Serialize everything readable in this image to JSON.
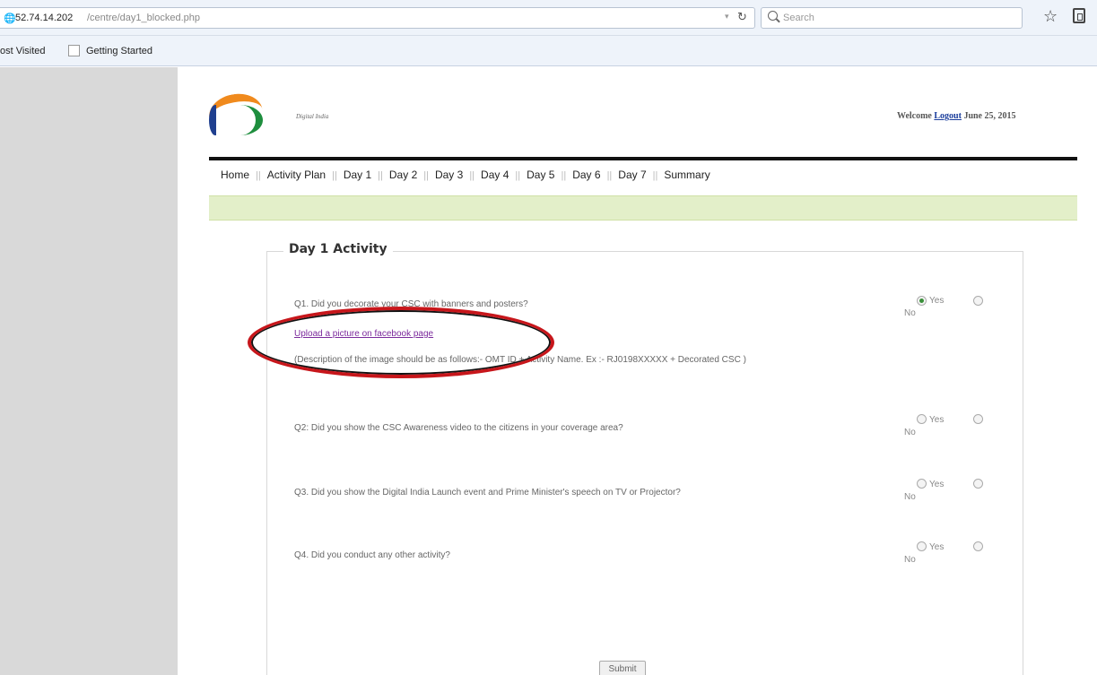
{
  "browser": {
    "url_host": "52.74.14.202",
    "url_path": "/centre/day1_blocked.php",
    "search_placeholder": "Search",
    "bookmarks": [
      "ost Visited",
      "Getting Started"
    ]
  },
  "header": {
    "logo_text": "Digital India",
    "welcome": "Welcome",
    "logout": "Logout",
    "date": "June 25, 2015"
  },
  "nav": {
    "items": [
      "Home",
      "Activity Plan",
      "Day 1",
      "Day 2",
      "Day 3",
      "Day 4",
      "Day 5",
      "Day 6",
      "Day 7",
      "Summary"
    ],
    "separator": "||"
  },
  "form": {
    "legend": "Day 1 Activity",
    "yes_label": "Yes",
    "no_label": "No",
    "questions": [
      {
        "text": "Q1. Did you decorate your CSC with banners and posters?",
        "selected": "Yes"
      },
      {
        "text": "Q2: Did you show the CSC Awareness video to the citizens in your coverage area?",
        "selected": ""
      },
      {
        "text": "Q3. Did you show the Digital India Launch event and Prime Minister's speech on TV or Projector?",
        "selected": ""
      },
      {
        "text": "Q4. Did you conduct any other activity?",
        "selected": ""
      }
    ],
    "upload_link": "Upload a picture on facebook page",
    "description": "(Description of the image should be as follows:- OMT ID + Activity Name. Ex :- RJ0198XXXXX + Decorated CSC )",
    "submit_label": "Submit"
  },
  "colors": {
    "annotation": "#c7161b",
    "green_band": "#e3efc9",
    "link": "#7b2a9c"
  }
}
